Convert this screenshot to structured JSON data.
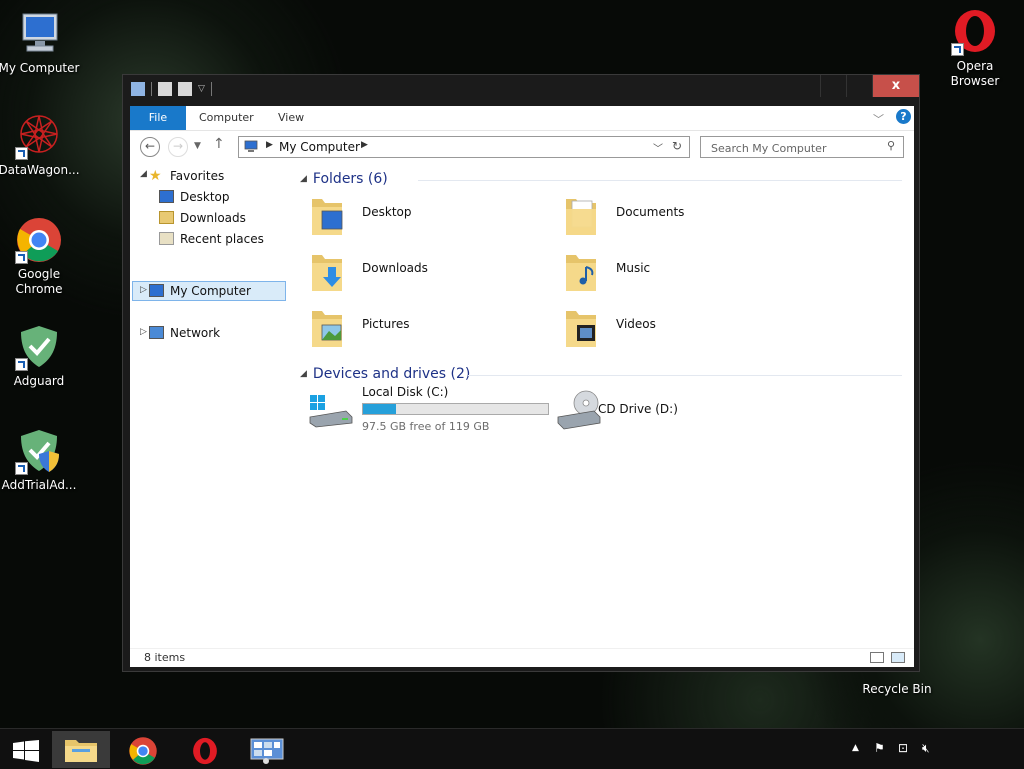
{
  "desktop": {
    "icons": [
      {
        "label": "My Computer"
      },
      {
        "label": "DataWagon..."
      },
      {
        "label": "Google Chrome"
      },
      {
        "label": "Adguard"
      },
      {
        "label": "AddTrialAd..."
      },
      {
        "label": "Opera Browser"
      },
      {
        "label": "Recycle Bin"
      }
    ]
  },
  "window": {
    "close_label": "x",
    "ribbon": {
      "tabs": [
        {
          "label": "File"
        },
        {
          "label": "Computer"
        },
        {
          "label": "View"
        }
      ],
      "help_label": "?"
    },
    "address": {
      "crumb": "My Computer",
      "search_placeholder": "Search My Computer"
    },
    "sidebar": {
      "favorites": "Favorites",
      "desktop": "Desktop",
      "downloads": "Downloads",
      "recent": "Recent places",
      "my_computer": "My Computer",
      "network": "Network"
    },
    "folders_header": "Folders (6)",
    "folders": [
      {
        "label": "Desktop"
      },
      {
        "label": "Documents"
      },
      {
        "label": "Downloads"
      },
      {
        "label": "Music"
      },
      {
        "label": "Pictures"
      },
      {
        "label": "Videos"
      }
    ],
    "devices_header": "Devices and drives (2)",
    "drives": [
      {
        "label": "Local Disk (C:)",
        "free": "97.5 GB free of 119 GB",
        "used_fraction": 0.18
      },
      {
        "label": "CD Drive (D:)"
      }
    ],
    "status": {
      "item_count": "8 items"
    }
  },
  "colors": {
    "accent": "#1979ca",
    "close": "#c7504a",
    "group_header": "#1e3287",
    "drive_fill": "#26a0da"
  }
}
